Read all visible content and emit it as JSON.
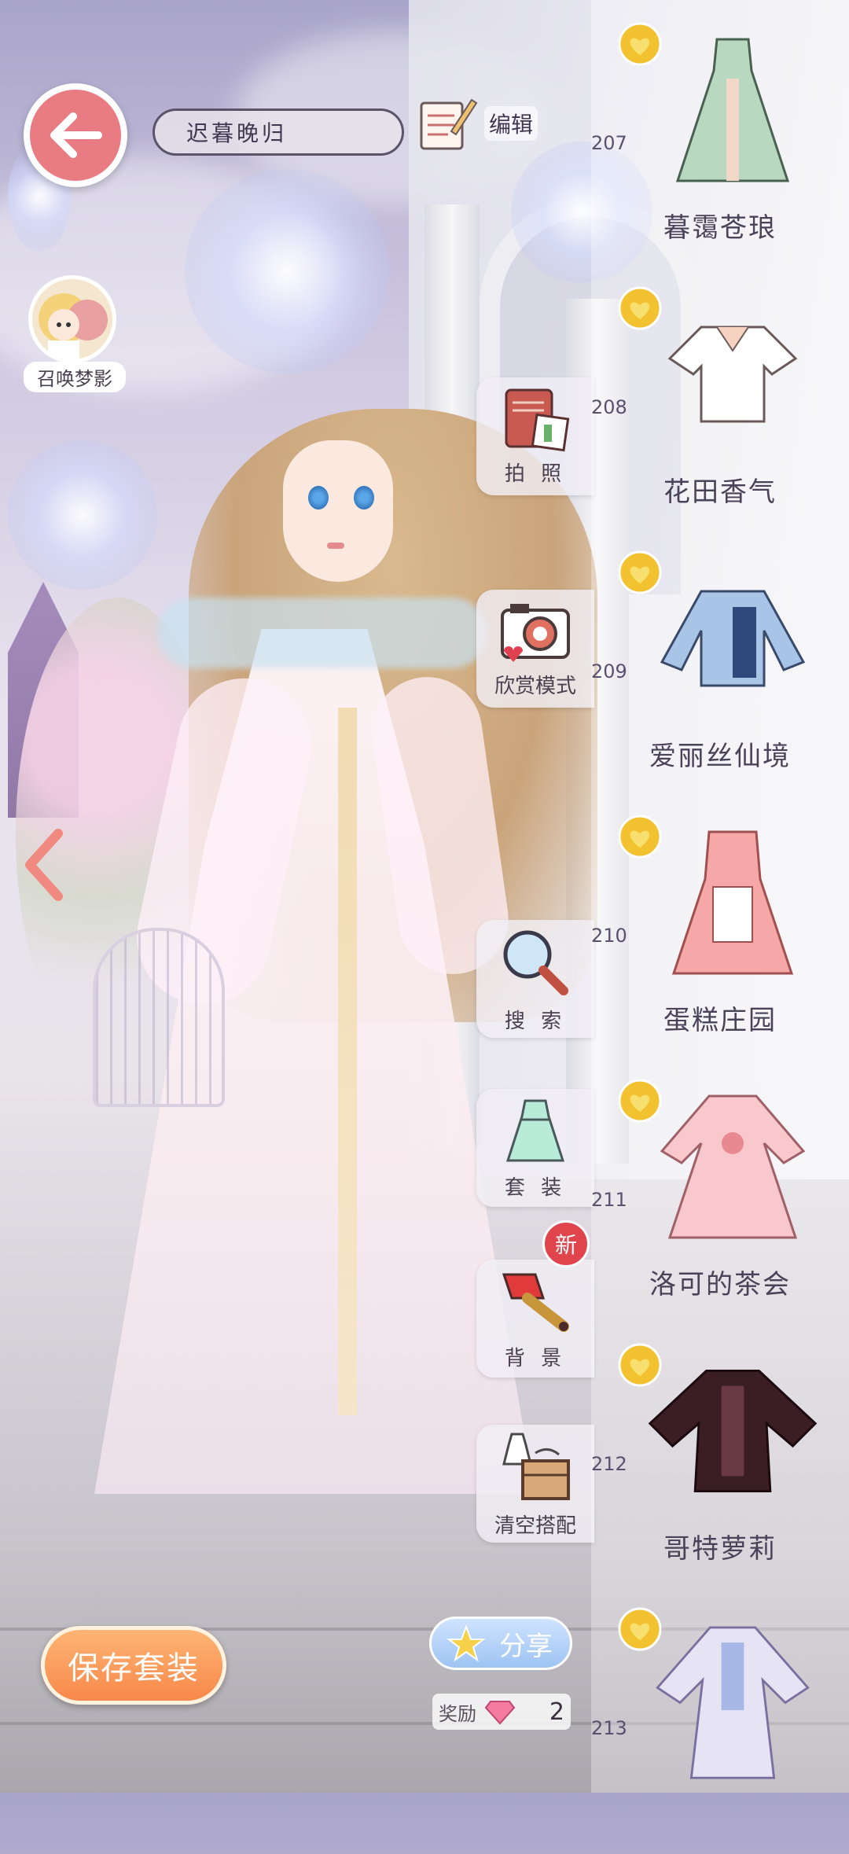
{
  "header": {
    "back_icon": "arrow-left-icon",
    "outfit_name": "迟暮晚归",
    "edit_label": "编辑"
  },
  "summon": {
    "label": "召唤梦影"
  },
  "side_menu": [
    {
      "id": "photo",
      "label": "拍 照",
      "icon": "photo-album-icon"
    },
    {
      "id": "appreciate",
      "label": "欣赏模式",
      "icon": "camera-icon"
    },
    {
      "id": "search",
      "label": "搜 索",
      "icon": "magnifier-icon"
    },
    {
      "id": "suits",
      "label": "套 装",
      "icon": "dress-icon"
    },
    {
      "id": "background",
      "label": "背 景",
      "icon": "paint-brush-icon"
    },
    {
      "id": "clear",
      "label": "清空搭配",
      "icon": "wardrobe-box-icon"
    }
  ],
  "new_badge": "新",
  "bottom": {
    "save_label": "保存套装",
    "share_label": "分享",
    "reward_label": "奖励",
    "reward_count": "2"
  },
  "wardrobe": [
    {
      "number": "207",
      "name": "暮霭苍琅",
      "medal": "gold-heart-medal-icon",
      "color": "#b8d8c0"
    },
    {
      "number": "208",
      "name": "花田香气",
      "medal": "gold-heart-medal-icon",
      "color": "#ffffff"
    },
    {
      "number": "209",
      "name": "爱丽丝仙境",
      "medal": "gold-heart-medal-icon",
      "color": "#a8c4e6"
    },
    {
      "number": "210",
      "name": "蛋糕庄园",
      "medal": "gold-heart-medal-icon",
      "color": "#f6a8a8"
    },
    {
      "number": "211",
      "name": "洛可的茶会",
      "medal": "gold-heart-medal-icon",
      "color": "#f8c8cc"
    },
    {
      "number": "212",
      "name": "哥特萝莉",
      "medal": "gold-heart-medal-icon",
      "color": "#3a1e24"
    },
    {
      "number": "213",
      "name": "",
      "medal": "gold-heart-medal-icon",
      "color": "#e6e4f4"
    }
  ],
  "colors": {
    "accent_pink": "#e87c82",
    "save_orange": "#f7884a",
    "share_blue": "#9ec4f2",
    "medal_gold": "#f2c230"
  }
}
